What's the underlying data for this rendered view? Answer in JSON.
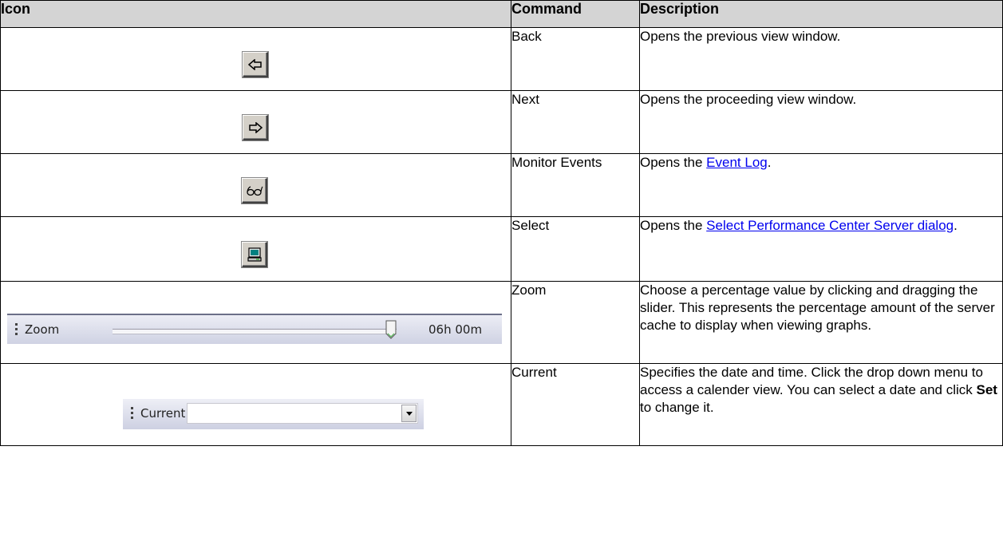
{
  "table": {
    "headers": {
      "icon": "Icon",
      "command": "Command",
      "description": "Description"
    },
    "rows": [
      {
        "icon": "back-arrow-icon",
        "command": "Back",
        "description": "Opens the previous view window."
      },
      {
        "icon": "next-arrow-icon",
        "command": "Next",
        "description": "Opens the proceeding view window."
      },
      {
        "icon": "glasses-icon",
        "command": "Monitor Events",
        "description_before": "Opens the ",
        "description_link": "Event Log",
        "description_after": "."
      },
      {
        "icon": "computer-monitor-icon",
        "command": "Select",
        "description_before": "Opens the ",
        "description_link": "Select Performance Center Server dialog",
        "description_after": "."
      },
      {
        "icon": "zoom-slider-toolbar",
        "command": "Zoom",
        "description": "Choose a percentage value by clicking and dragging the slider. This represents the percentage amount of the server cache to display when viewing graphs.",
        "toolbar": {
          "label": "Zoom",
          "value": "06h 00m",
          "slider_fraction": 0.98
        }
      },
      {
        "icon": "current-date-toolbar",
        "command": "Current",
        "description_before": "Specifies the date and time. Click the drop down menu to access a calender view. You can select a date and click ",
        "description_bold": "Set",
        "description_after": " to change it.",
        "toolbar": {
          "label": "Current",
          "value": ""
        }
      }
    ]
  },
  "colors": {
    "header_bg": "#d4d4d4",
    "link": "#0000ee",
    "button_face": "#d4d0c8"
  }
}
